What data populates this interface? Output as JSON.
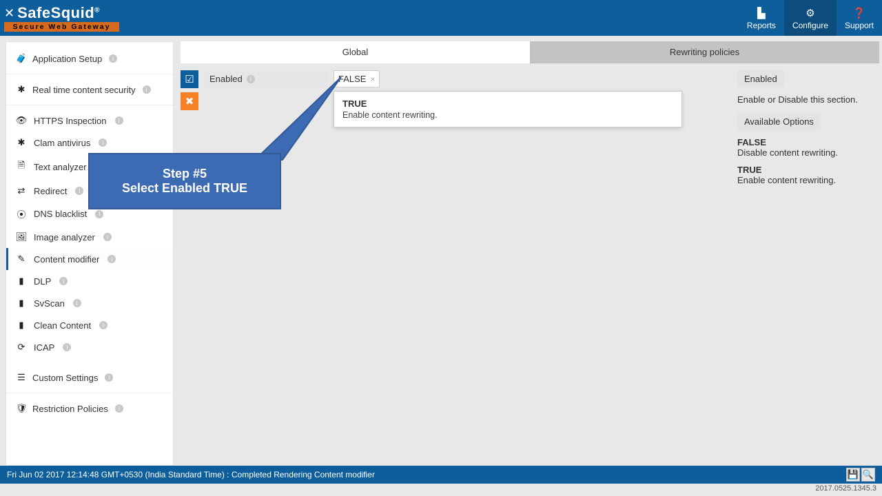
{
  "brand": {
    "name": "SafeSquid",
    "reg": "®",
    "tagline": "Secure Web Gateway"
  },
  "topnav": {
    "reports": "Reports",
    "configure": "Configure",
    "support": "Support"
  },
  "sidebar": {
    "appSetup": "Application Setup",
    "realtime": "Real time content security",
    "items": [
      {
        "icon": "👁",
        "label": "HTTPS Inspection"
      },
      {
        "icon": "✱",
        "label": "Clam antivirus"
      },
      {
        "icon": "🗎",
        "label": "Text analyzer"
      },
      {
        "icon": "⇄",
        "label": "Redirect"
      },
      {
        "icon": "⦿",
        "label": "DNS blacklist"
      },
      {
        "icon": "🖼",
        "label": "Image analyzer"
      },
      {
        "icon": "✎",
        "label": "Content modifier"
      },
      {
        "icon": "▮",
        "label": "DLP"
      },
      {
        "icon": "▮",
        "label": "SvScan"
      },
      {
        "icon": "▮",
        "label": "Clean Content"
      },
      {
        "icon": "⟳",
        "label": "ICAP"
      }
    ],
    "custom": "Custom Settings",
    "restriction": "Restriction Policies"
  },
  "tabs": {
    "global": "Global",
    "policies": "Rewriting policies"
  },
  "field": {
    "label": "Enabled",
    "current": "FALSE",
    "dropdown": {
      "title": "TRUE",
      "desc": "Enable content rewriting."
    }
  },
  "info": {
    "heading": "Enabled",
    "desc": "Enable or Disable this section.",
    "available": "Available Options",
    "options": [
      {
        "t": "FALSE",
        "d": "Disable content rewriting."
      },
      {
        "t": "TRUE",
        "d": "Enable content rewriting."
      }
    ]
  },
  "callout": {
    "l1": "Step #5",
    "l2": "Select Enabled TRUE"
  },
  "status": {
    "text": "Fri Jun 02 2017 12:14:48 GMT+0530 (India Standard Time) : Completed Rendering Content modifier"
  },
  "version": "2017.0525.1345.3"
}
